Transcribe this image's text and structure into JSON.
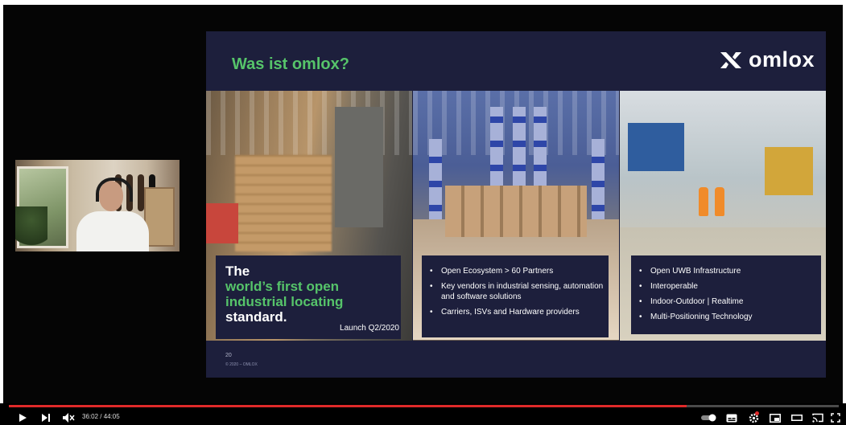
{
  "slide": {
    "title": "Was ist omlox?",
    "logo_text": "omlox",
    "panel1": {
      "line1": "The",
      "line2": "world’s first open",
      "line3": "industrial locating",
      "line4": "standard.",
      "launch": "Launch Q2/2020"
    },
    "panel2_bullets": [
      "Open Ecosystem  > 60 Partners",
      "Key vendors in industrial sensing, automation and software solutions",
      "Carriers, ISVs and Hardware providers"
    ],
    "panel3_bullets": [
      "Open UWB Infrastructure",
      "Interoperable",
      "Indoor-Outdoor   | Realtime",
      "Multi-Positioning Technology"
    ],
    "page_number": "20",
    "copyright": "© 2020 – OMLOX"
  },
  "player": {
    "time": "36:02 / 44:05",
    "progress_fraction": 0.817,
    "accent_color": "#e02a2a"
  },
  "icons": [
    "play-icon",
    "next-icon",
    "mute-icon",
    "autoplay-toggle-icon",
    "subtitles-icon",
    "settings-icon",
    "miniplayer-icon",
    "theater-icon",
    "cast-icon",
    "fullscreen-icon"
  ]
}
